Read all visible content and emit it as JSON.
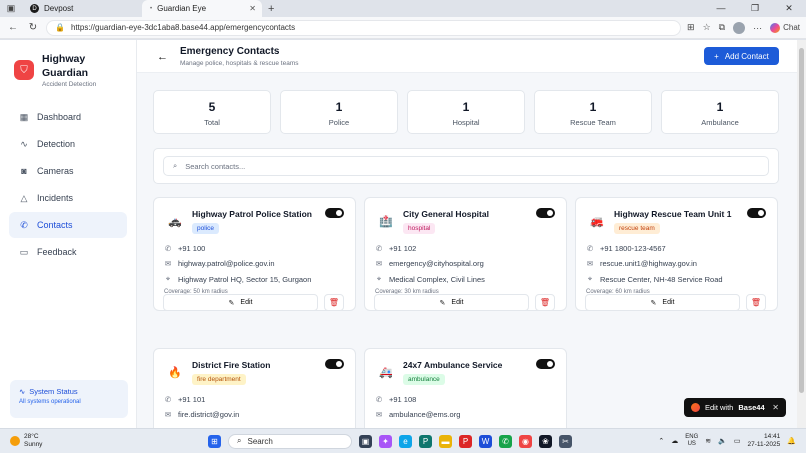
{
  "browser": {
    "tabs": [
      {
        "label": "Devpost"
      },
      {
        "label": "Guardian Eye"
      }
    ],
    "url": "https://guardian-eye-3dc1aba8.base44.app/emergencycontacts",
    "chat_label": "Chat"
  },
  "sidebar": {
    "app_name_line1": "Highway",
    "app_name_line2": "Guardian",
    "app_tagline": "Accident Detection",
    "items": [
      {
        "label": "Dashboard",
        "icon": "grid-icon"
      },
      {
        "label": "Detection",
        "icon": "activity-icon"
      },
      {
        "label": "Cameras",
        "icon": "camera-icon"
      },
      {
        "label": "Incidents",
        "icon": "warning-icon"
      },
      {
        "label": "Contacts",
        "icon": "phone-icon",
        "active": true
      },
      {
        "label": "Feedback",
        "icon": "message-icon"
      }
    ],
    "status": {
      "title": "System Status",
      "text": "All systems operational"
    }
  },
  "header": {
    "title": "Emergency Contacts",
    "subtitle": "Manage police, hospitals & rescue teams",
    "add_label": "Add Contact"
  },
  "stats": [
    {
      "value": "5",
      "label": "Total"
    },
    {
      "value": "1",
      "label": "Police"
    },
    {
      "value": "1",
      "label": "Hospital"
    },
    {
      "value": "1",
      "label": "Rescue Team"
    },
    {
      "value": "1",
      "label": "Ambulance"
    }
  ],
  "search": {
    "placeholder": "Search contacts..."
  },
  "edit_label": "Edit",
  "contacts": [
    {
      "name": "Highway Patrol Police Station",
      "type": "police",
      "icon": "police-car-icon",
      "badge_bg": "#dbeafe",
      "badge_fg": "#1d4ed8",
      "phone": "+91 100",
      "email": "highway.patrol@police.gov.in",
      "address": "Highway Patrol HQ, Sector 15, Gurgaon",
      "coverage": "Coverage: 50 km radius"
    },
    {
      "name": "City General Hospital",
      "type": "hospital",
      "icon": "hospital-icon",
      "badge_bg": "#fce7f3",
      "badge_fg": "#be185d",
      "phone": "+91 102",
      "email": "emergency@cityhospital.org",
      "address": "Medical Complex, Civil Lines",
      "coverage": "Coverage: 30 km radius"
    },
    {
      "name": "Highway Rescue Team Unit 1",
      "type": "rescue team",
      "icon": "fire-truck-icon",
      "badge_bg": "#ffedd5",
      "badge_fg": "#c2410c",
      "phone": "+91 1800-123-4567",
      "email": "rescue.unit1@highway.gov.in",
      "address": "Rescue Center, NH-48 Service Road",
      "coverage": "Coverage: 60 km radius"
    },
    {
      "name": "District Fire Station",
      "type": "fire department",
      "icon": "fire-icon",
      "badge_bg": "#fef3c7",
      "badge_fg": "#b45309",
      "phone": "+91 101",
      "email": "fire.district@gov.in",
      "address": "",
      "coverage": ""
    },
    {
      "name": "24x7 Ambulance Service",
      "type": "ambulance",
      "icon": "ambulance-icon",
      "badge_bg": "#dcfce7",
      "badge_fg": "#15803d",
      "phone": "+91 108",
      "email": "ambulance@ems.org",
      "address": "",
      "coverage": ""
    }
  ],
  "base44": {
    "label": "Edit with",
    "brand": "Base44"
  },
  "taskbar": {
    "temp": "28°C",
    "weather": "Sunny",
    "search_label": "Search",
    "lang1": "ENG",
    "lang2": "US",
    "time": "14:41",
    "date": "27-11-2025"
  }
}
